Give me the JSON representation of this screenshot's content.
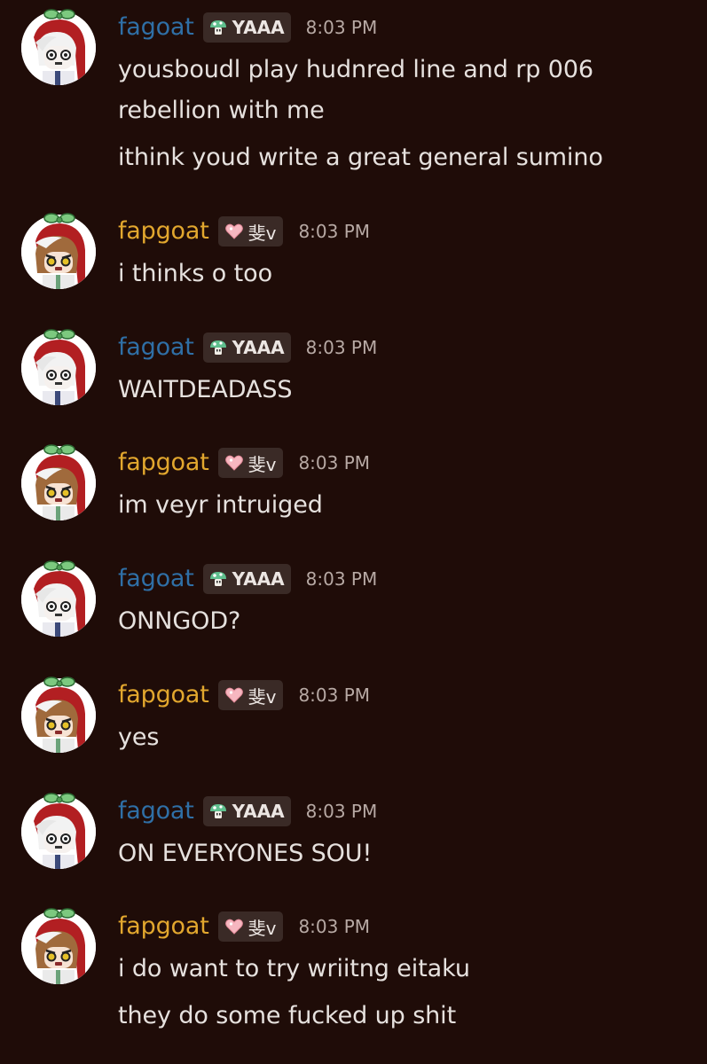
{
  "colors": {
    "background": "#1f0c08",
    "username_fagoat": "#2f6fa6",
    "username_fapgoat": "#e2a72e",
    "tag_background": "#3a2a26",
    "text": "#e6e1de",
    "timestamp": "#b7a9a4"
  },
  "messages": [
    {
      "username": "fagoat",
      "tag_icon": "green-mushroom-icon",
      "tag_text": "YAAA",
      "timestamp": "8:03 PM",
      "lines": [
        "yousboudl play hudnred line and rp 006",
        "rebellion with me",
        "ithink youd write a great general sumino"
      ]
    },
    {
      "username": "fapgoat",
      "tag_icon": "pink-heart-icon",
      "tag_text": "斐v",
      "timestamp": "8:03 PM",
      "lines": [
        "i thinks o too"
      ]
    },
    {
      "username": "fagoat",
      "tag_icon": "green-mushroom-icon",
      "tag_text": "YAAA",
      "timestamp": "8:03 PM",
      "lines": [
        "WAITDEADASS"
      ]
    },
    {
      "username": "fapgoat",
      "tag_icon": "pink-heart-icon",
      "tag_text": "斐v",
      "timestamp": "8:03 PM",
      "lines": [
        "im veyr intruiged"
      ]
    },
    {
      "username": "fagoat",
      "tag_icon": "green-mushroom-icon",
      "tag_text": "YAAA",
      "timestamp": "8:03 PM",
      "lines": [
        "ONNGOD?"
      ]
    },
    {
      "username": "fapgoat",
      "tag_icon": "pink-heart-icon",
      "tag_text": "斐v",
      "timestamp": "8:03 PM",
      "lines": [
        "yes"
      ]
    },
    {
      "username": "fagoat",
      "tag_icon": "green-mushroom-icon",
      "tag_text": "YAAA",
      "timestamp": "8:03 PM",
      "lines": [
        "ON EVERYONES SOU!"
      ]
    },
    {
      "username": "fapgoat",
      "tag_icon": "pink-heart-icon",
      "tag_text": "斐v",
      "timestamp": "8:03 PM",
      "lines": [
        "i do want to try wriitng eitaku",
        "they do some fucked up shit"
      ]
    }
  ]
}
